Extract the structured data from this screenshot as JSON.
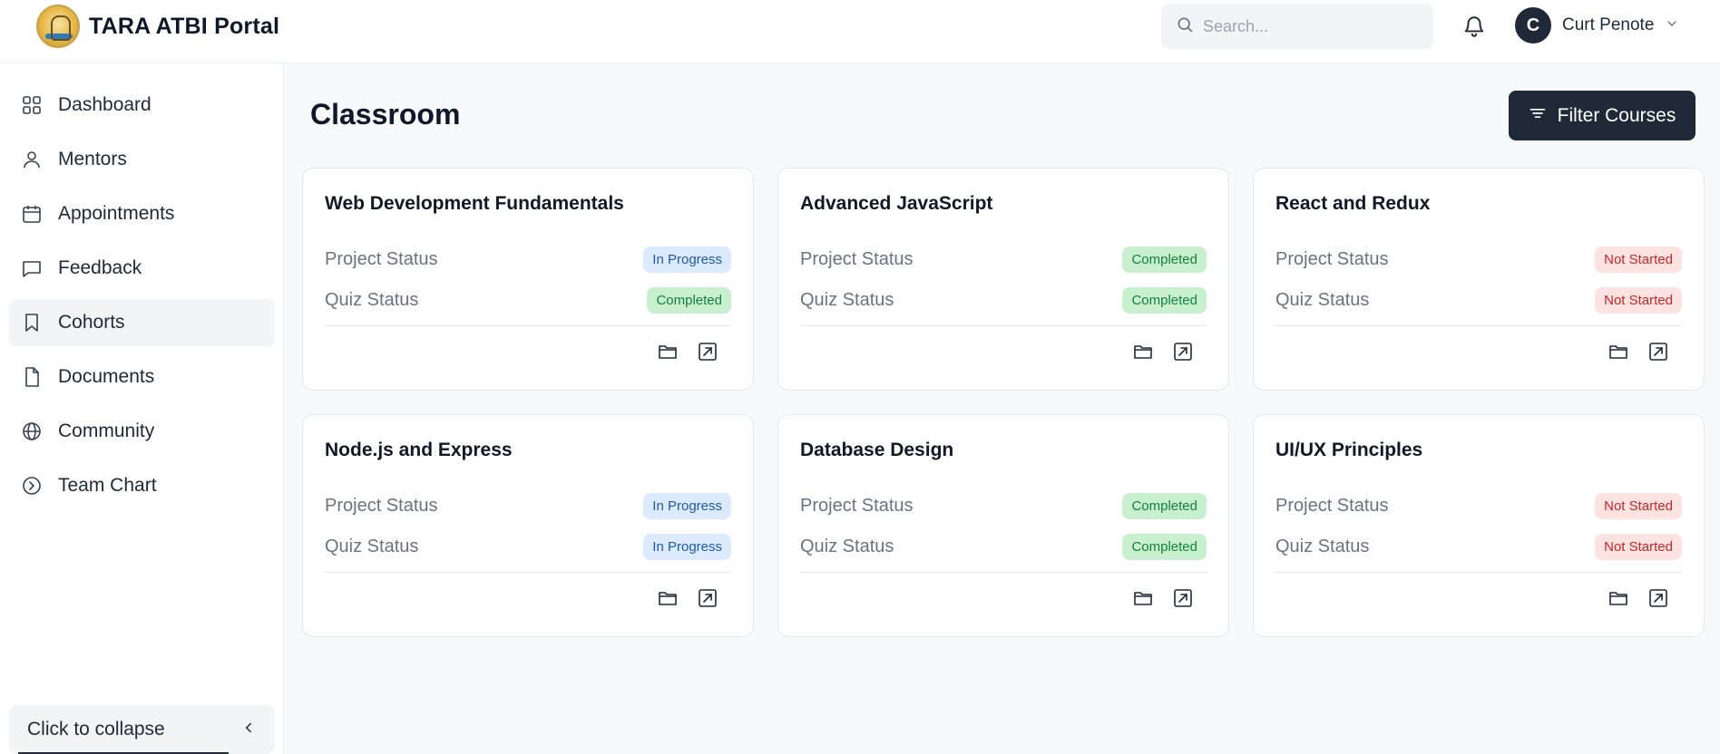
{
  "header": {
    "brand_title": "TARA ATBI Portal",
    "search_placeholder": "Search...",
    "user_initial": "C",
    "user_name": "Curt Penote"
  },
  "sidebar": {
    "items": [
      {
        "label": "Dashboard",
        "icon": "grid-icon"
      },
      {
        "label": "Mentors",
        "icon": "user-icon"
      },
      {
        "label": "Appointments",
        "icon": "calendar-icon"
      },
      {
        "label": "Feedback",
        "icon": "message-icon"
      },
      {
        "label": "Cohorts",
        "icon": "bookmark-icon",
        "active": true
      },
      {
        "label": "Documents",
        "icon": "document-icon"
      },
      {
        "label": "Community",
        "icon": "globe-icon"
      },
      {
        "label": "Team Chart",
        "icon": "chevron-circle-icon"
      }
    ],
    "collapse_label": "Click to collapse"
  },
  "main": {
    "title": "Classroom",
    "filter_label": "Filter Courses",
    "project_label": "Project Status",
    "quiz_label": "Quiz Status",
    "courses": [
      {
        "title": "Web Development Fundamentals",
        "project_status": "In Progress",
        "quiz_status": "Completed"
      },
      {
        "title": "Advanced JavaScript",
        "project_status": "Completed",
        "quiz_status": "Completed"
      },
      {
        "title": "React and Redux",
        "project_status": "Not Started",
        "quiz_status": "Not Started"
      },
      {
        "title": "Node.js and Express",
        "project_status": "In Progress",
        "quiz_status": "In Progress"
      },
      {
        "title": "Database Design",
        "project_status": "Completed",
        "quiz_status": "Completed"
      },
      {
        "title": "UI/UX Principles",
        "project_status": "Not Started",
        "quiz_status": "Not Started"
      }
    ]
  },
  "colors": {
    "dark": "#1f2937",
    "in_progress_bg": "#dbeafe",
    "completed_bg": "#c8f0cf",
    "not_started_bg": "#fde2e2"
  }
}
